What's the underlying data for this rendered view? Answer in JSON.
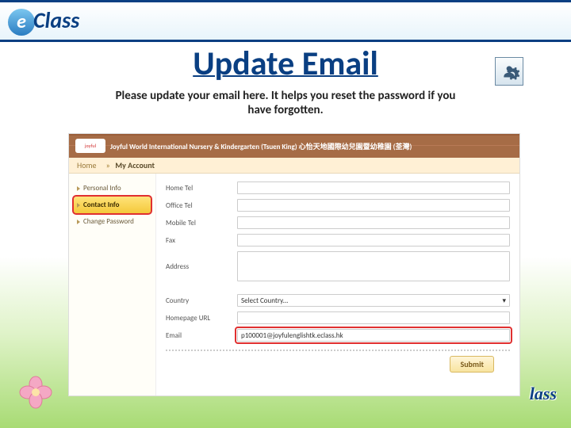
{
  "logo_text": "Class",
  "title": "Update Email",
  "subtitle": "Please update your email here. It helps you reset the password if you have forgotten.",
  "screenshot": {
    "school_logo": "joyful",
    "school_name": "Joyful World International Nursery & Kindergarten (Tsuen King) 心怡天地國際幼兒園暨幼稚園 (荃灣)",
    "breadcrumb_home": "Home",
    "breadcrumb_sep": "»",
    "breadcrumb_current": "My Account",
    "sidebar": [
      {
        "label": "Personal Info",
        "active": false,
        "hl": false
      },
      {
        "label": "Contact Info",
        "active": true,
        "hl": true
      },
      {
        "label": "Change Password",
        "active": false,
        "hl": false
      }
    ],
    "fields": {
      "home_tel": {
        "label": "Home Tel",
        "value": ""
      },
      "office_tel": {
        "label": "Office Tel",
        "value": ""
      },
      "mobile_tel": {
        "label": "Mobile Tel",
        "value": ""
      },
      "fax": {
        "label": "Fax",
        "value": ""
      },
      "address": {
        "label": "Address",
        "value": ""
      },
      "country": {
        "label": "Country",
        "value": "Select Country..."
      },
      "homepage": {
        "label": "Homepage URL",
        "value": ""
      },
      "email": {
        "label": "Email",
        "value": "p100001@joyfulenglishtk.eclass.hk"
      }
    },
    "submit": "Submit"
  },
  "bottom_logo": "lass"
}
